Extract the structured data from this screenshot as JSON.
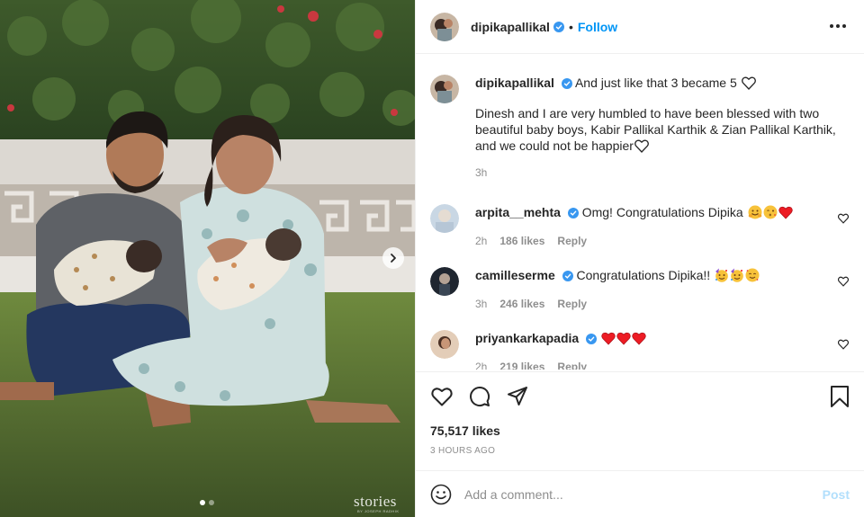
{
  "post": {
    "username": "dipikapallikal",
    "follow_label": "Follow",
    "separator": "•",
    "caption_title": "And just like that 3 became 5",
    "caption_body": "Dinesh and I are very humbled to have been blessed with two beautiful baby boys, Kabir Pallikal Karthik & Zian Pallikal Karthik, and we could not be happier",
    "caption_time": "3h",
    "like_count": "75,517 likes",
    "posted_ago": "3 HOURS AGO",
    "image": {
      "watermark": "stories",
      "watermark_sub": "BY JOSEPH RADHIK",
      "slide_count": 2,
      "active_slide": 1
    }
  },
  "comments": [
    {
      "username": "arpita__mehta",
      "text": "Omg! Congratulations Dipika",
      "emojis": [
        "hugging-face",
        "kissing-face",
        "red-heart"
      ],
      "time": "2h",
      "likes": "186 likes",
      "reply": "Reply"
    },
    {
      "username": "camilleserme",
      "text": "Congratulations Dipika!!",
      "emojis": [
        "partying-face",
        "partying-face",
        "smiling-face-with-hearts"
      ],
      "time": "3h",
      "likes": "246 likes",
      "reply": "Reply"
    },
    {
      "username": "priyankarkapadia",
      "text": "",
      "emojis": [
        "red-heart",
        "red-heart",
        "red-heart"
      ],
      "time": "2h",
      "likes": "219 likes",
      "reply": "Reply"
    }
  ],
  "composer": {
    "placeholder": "Add a comment...",
    "post_label": "Post"
  },
  "colors": {
    "accent": "#0095f6",
    "verified": "#3897f0",
    "heart_red": "#ed1c24",
    "muted": "#8e8e8e",
    "post_disabled": "#b2dffc"
  }
}
